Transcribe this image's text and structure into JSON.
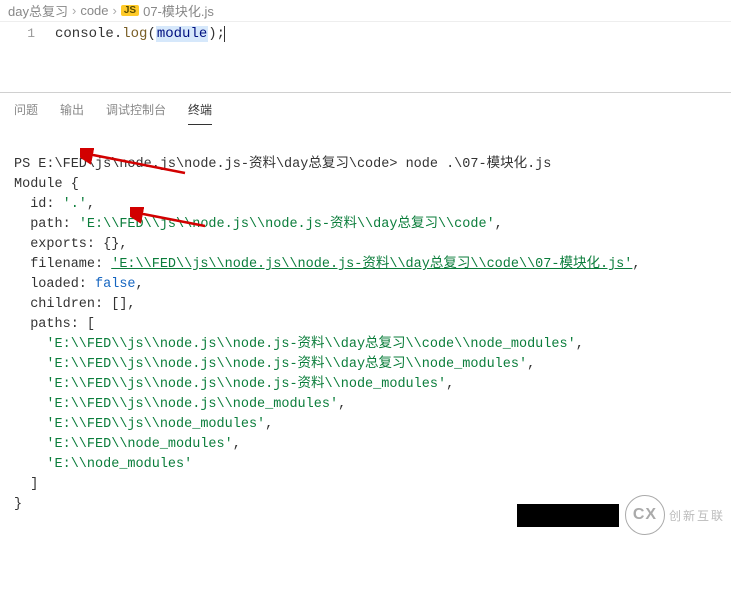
{
  "breadcrumb": {
    "seg1": "day总复习",
    "seg2": "code",
    "badge": "JS",
    "file": "07-模块化.js"
  },
  "editor": {
    "lineno": "1",
    "t_console": "console",
    "t_dot": ".",
    "t_log": "log",
    "t_open": "(",
    "t_module": "module",
    "t_close": ")",
    "t_semi": ";"
  },
  "tabs": {
    "problems": "问题",
    "output": "输出",
    "debug": "调试控制台",
    "terminal": "终端"
  },
  "terminal": {
    "prompt": "PS E:\\FED\\js\\node.js\\node.js-资料\\day总复习\\code> ",
    "command": "node .\\07-模块化.js",
    "out_module": "Module {",
    "out_id_key": "  id: ",
    "out_id_val": "'.'",
    "out_path_key": "  path: ",
    "out_path_val": "'E:\\\\FED\\\\js\\\\node.js\\\\node.js-资料\\\\day总复习\\\\code'",
    "out_exports": "  exports: {},",
    "out_filename_key": "  filename: ",
    "out_filename_val": "'E:\\\\FED\\\\js\\\\node.js\\\\node.js-资料\\\\day总复习\\\\code\\\\07-模块化.js'",
    "out_loaded_key": "  loaded: ",
    "out_loaded_val": "false",
    "out_children": "  children: [],",
    "out_paths_open": "  paths: [",
    "paths": [
      "'E:\\\\FED\\\\js\\\\node.js\\\\node.js-资料\\\\day总复习\\\\code\\\\node_modules'",
      "'E:\\\\FED\\\\js\\\\node.js\\\\node.js-资料\\\\day总复习\\\\node_modules'",
      "'E:\\\\FED\\\\js\\\\node.js\\\\node.js-资料\\\\node_modules'",
      "'E:\\\\FED\\\\js\\\\node.js\\\\node_modules'",
      "'E:\\\\FED\\\\js\\\\node_modules'",
      "'E:\\\\FED\\\\node_modules'",
      "'E:\\\\node_modules'"
    ],
    "out_paths_close": "  ]",
    "out_close": "}"
  },
  "watermark": {
    "logo": "CX",
    "text": "创新互联"
  },
  "comma": ","
}
